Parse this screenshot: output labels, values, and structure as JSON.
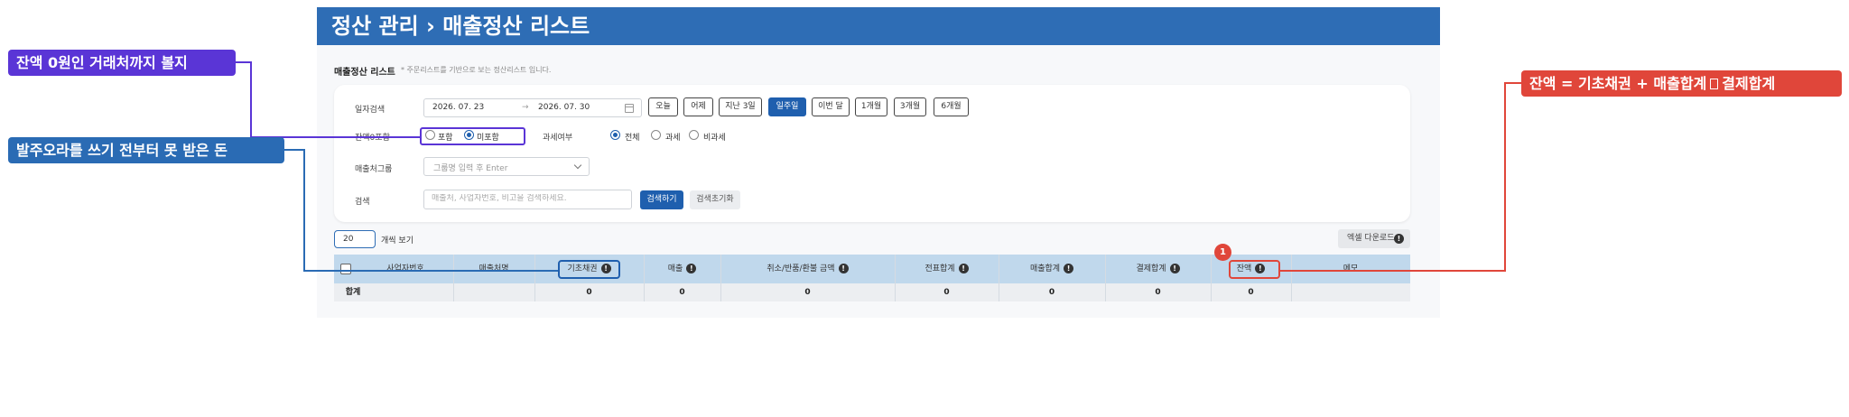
{
  "header": {
    "title": "정산 관리 › 매출정산 리스트"
  },
  "section": {
    "title": "매출정산 리스트",
    "note": "* 주문리스트를 기반으로 보는 정산리스트 입니다."
  },
  "filters": {
    "date_label": "일자검색",
    "date_start": "2026. 07. 23",
    "date_arrow": "→",
    "date_end": "2026. 07. 30",
    "quick_buttons": [
      "오늘",
      "어제",
      "지난 3일",
      "일주일",
      "이번 달",
      "1개월",
      "3개월",
      "6개월"
    ],
    "quick_active": "일주일",
    "zero_balance_label": "잔액0포함",
    "zero_balance_options": [
      "포함",
      "미포함"
    ],
    "zero_balance_selected": "미포함",
    "tax_label": "과세여부",
    "tax_options": [
      "전체",
      "과세",
      "비과세"
    ],
    "tax_selected": "전체",
    "group_label": "매출처그룹",
    "group_placeholder": "그룹명 입력 후 Enter",
    "search_label": "검색",
    "search_placeholder": "매출처, 사업자번호, 비고을 검색하세요.",
    "search_button": "검색하기",
    "reset_button": "검색초기화"
  },
  "list_controls": {
    "page_size": "20",
    "page_size_suffix": "개씩 보기",
    "excel_button": "엑셀 다운로드"
  },
  "table": {
    "headers": [
      "사업자번호",
      "매출처명",
      "기초채권",
      "매출",
      "취소/반품/환불 금액",
      "전표합계",
      "매출합계",
      "결제합계",
      "잔액",
      "메모"
    ],
    "footer": {
      "label": "합계",
      "values": [
        "0",
        "0",
        "0",
        "0",
        "0",
        "0",
        "0"
      ]
    }
  },
  "badge": "1",
  "callouts": {
    "purple": "잔액 0원인 거래처까지 볼지",
    "blue": "발주오라를 쓰기 전부터 못 받은 돈",
    "red_prefix": "잔액 = 기초채권 + 매출합계",
    "red_suffix": "결제합계"
  },
  "colors": {
    "header_blue": "#2e6db5",
    "primary": "#1f5fae",
    "purple": "#5a35d6",
    "callout_blue": "#2a6bb4",
    "red": "#e0463a",
    "table_header": "#c0d8ec"
  }
}
